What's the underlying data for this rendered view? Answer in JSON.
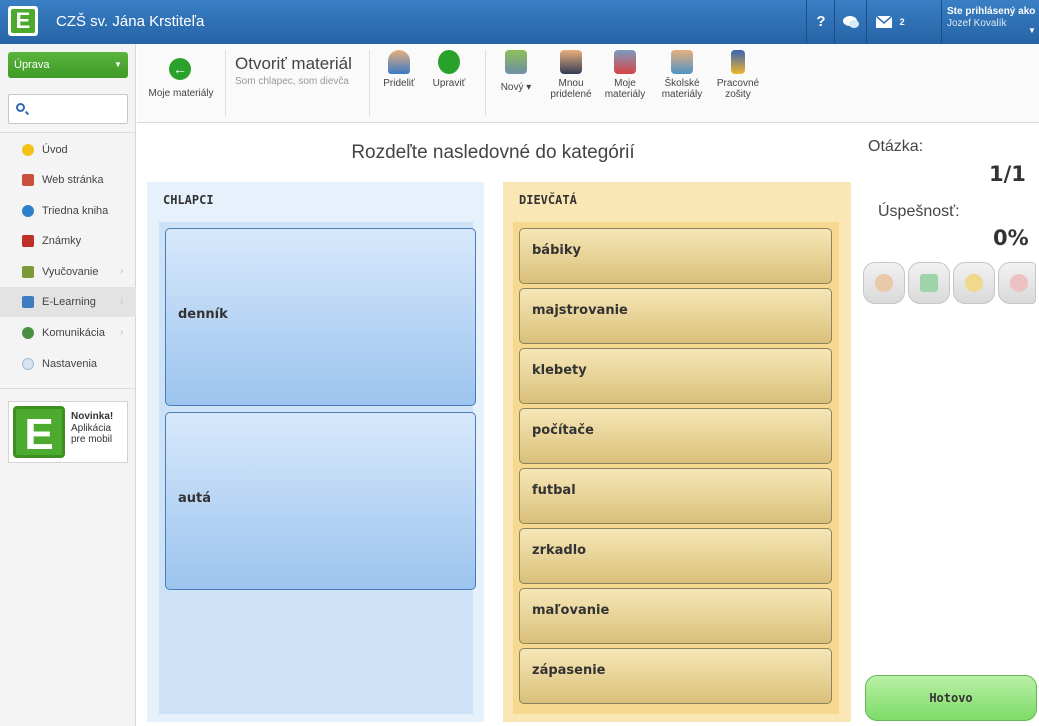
{
  "header": {
    "logo_letter": "E",
    "school": "CZŠ sv. Jána Krstiteľa",
    "help": "?",
    "messages_count": "2",
    "user_line1": "Ste prihlásený ako",
    "user_line2": "Jozef Kovalík"
  },
  "sidebar": {
    "uprava_label": "Úprava",
    "search_value": "",
    "items": [
      {
        "label": "Úvod",
        "icon": "star-icon"
      },
      {
        "label": "Web stránka",
        "icon": "web-icon"
      },
      {
        "label": "Triedna kniha",
        "icon": "book-icon"
      },
      {
        "label": "Známky",
        "icon": "grades-icon"
      },
      {
        "label": "Vyučovanie",
        "icon": "teaching-icon"
      },
      {
        "label": "E-Learning",
        "icon": "elearning-icon"
      },
      {
        "label": "Komunikácia",
        "icon": "communication-icon"
      },
      {
        "label": "Nastavenia",
        "icon": "settings-icon"
      }
    ],
    "promo_letter": "E",
    "promo_title": "Novinka!",
    "promo_line2": "Aplikácia",
    "promo_line3": "pre mobil"
  },
  "toolbar": {
    "my_materials": "Moje materiály",
    "open_title": "Otvoriť materiál",
    "open_subtitle": "Som chlapec, som dievča",
    "assign": "Prideliť",
    "edit": "Upraviť",
    "new": "Nový",
    "new_caret": "▾",
    "my_assigned_1": "Mnou",
    "my_assigned_2": "pridelené",
    "my_materials2_1": "Moje",
    "my_materials2_2": "materiály",
    "school_materials_1": "Školské",
    "school_materials_2": "materiály",
    "workbooks_1": "Pracovné",
    "workbooks_2": "zošity"
  },
  "exercise": {
    "instruction": "Rozdeľte nasledovné do kategórií",
    "category_boys": "CHLAPCI",
    "category_girls": "DIEVČATÁ",
    "boys_items": [
      "denník",
      "autá"
    ],
    "girls_items": [
      "bábiky",
      "majstrovanie",
      "klebety",
      "počítače",
      "futbal",
      "zrkadlo",
      "maľovanie",
      "zápasenie"
    ]
  },
  "side_panel": {
    "question_label": "Otázka:",
    "question_value": "1/1",
    "success_label": "Úspešnosť:",
    "success_value": "0%",
    "done": "Hotovo"
  },
  "colors": {
    "header_blue": "#2f72b6",
    "brand_green": "#4caa2f",
    "boys_bg": "#e6f1fb",
    "girls_bg": "#fbe6b5"
  }
}
